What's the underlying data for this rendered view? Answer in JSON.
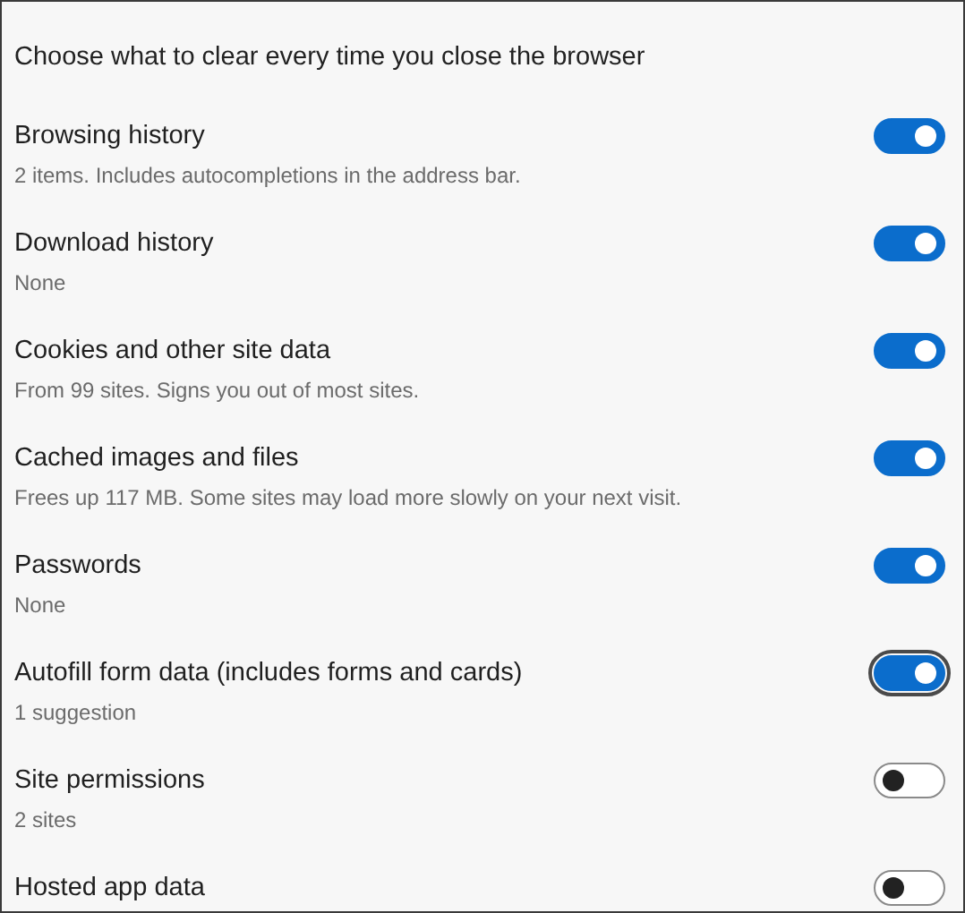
{
  "heading": "Choose what to clear every time you close the browser",
  "items": [
    {
      "title": "Browsing history",
      "description": "2 items. Includes autocompletions in the address bar.",
      "on": true,
      "focused": false
    },
    {
      "title": "Download history",
      "description": "None",
      "on": true,
      "focused": false
    },
    {
      "title": "Cookies and other site data",
      "description": "From 99 sites. Signs you out of most sites.",
      "on": true,
      "focused": false
    },
    {
      "title": "Cached images and files",
      "description": "Frees up 117 MB. Some sites may load more slowly on your next visit.",
      "on": true,
      "focused": false
    },
    {
      "title": "Passwords",
      "description": "None",
      "on": true,
      "focused": false
    },
    {
      "title": "Autofill form data (includes forms and cards)",
      "description": "1 suggestion",
      "on": true,
      "focused": true
    },
    {
      "title": "Site permissions",
      "description": "2 sites",
      "on": false,
      "focused": false
    },
    {
      "title": "Hosted app data",
      "on": false,
      "focused": false
    }
  ]
}
